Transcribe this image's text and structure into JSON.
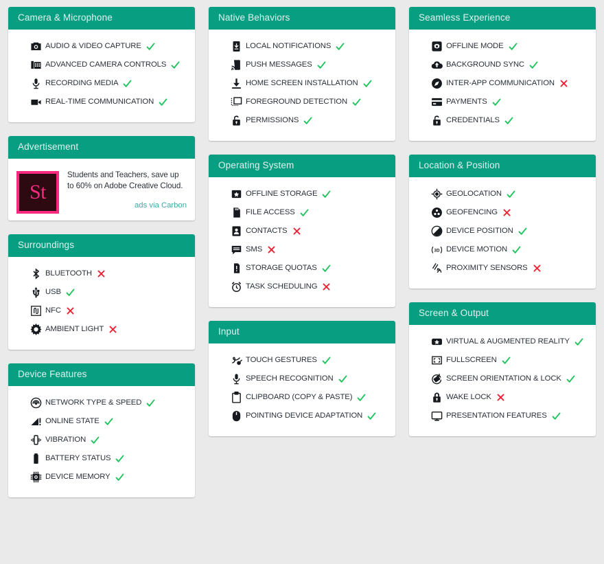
{
  "theme": {
    "header_bg": "#089e82",
    "page_bg": "#eaeaea",
    "card_bg": "#ffffff",
    "label_color": "#2a3039",
    "yes_color": "#1fc55c",
    "no_color": "#ee2233",
    "link_color": "#3fa9a2",
    "ad_accent": "#f72a7f",
    "ad_bg": "#2d0a12"
  },
  "columns": [
    {
      "cards": [
        {
          "title": "Camera & Microphone",
          "type": "features",
          "features": [
            {
              "icon": "camera-icon",
              "label": "AUDIO & VIDEO CAPTURE",
              "status": "yes"
            },
            {
              "icon": "advanced-camera-icon",
              "label": "ADVANCED CAMERA CONTROLS",
              "status": "yes"
            },
            {
              "icon": "microphone-icon",
              "label": "RECORDING MEDIA",
              "status": "yes"
            },
            {
              "icon": "video-camera-icon",
              "label": "REAL-TIME COMMUNICATION",
              "status": "yes"
            }
          ]
        },
        {
          "title": "Advertisement",
          "type": "ad",
          "ad": {
            "logo_text": "St",
            "body": "Students and Teachers, save up to 60% on Adobe Creative Cloud.",
            "link": "ads via Carbon"
          }
        },
        {
          "title": "Surroundings",
          "type": "features",
          "features": [
            {
              "icon": "bluetooth-icon",
              "label": "BLUETOOTH",
              "status": "no"
            },
            {
              "icon": "usb-icon",
              "label": "USB",
              "status": "yes"
            },
            {
              "icon": "nfc-icon",
              "label": "NFC",
              "status": "no"
            },
            {
              "icon": "ambient-light-icon",
              "label": "AMBIENT LIGHT",
              "status": "no"
            }
          ]
        },
        {
          "title": "Device Features",
          "type": "features",
          "features": [
            {
              "icon": "network-speed-icon",
              "label": "NETWORK TYPE & SPEED",
              "status": "yes"
            },
            {
              "icon": "online-state-icon",
              "label": "ONLINE STATE",
              "status": "yes"
            },
            {
              "icon": "vibration-icon",
              "label": "VIBRATION",
              "status": "yes"
            },
            {
              "icon": "battery-icon",
              "label": "BATTERY STATUS",
              "status": "yes"
            },
            {
              "icon": "memory-chip-icon",
              "label": "DEVICE MEMORY",
              "status": "yes"
            }
          ]
        }
      ]
    },
    {
      "cards": [
        {
          "title": "Native Behaviors",
          "type": "features",
          "features": [
            {
              "icon": "local-notification-icon",
              "label": "LOCAL NOTIFICATIONS",
              "status": "yes"
            },
            {
              "icon": "push-message-icon",
              "label": "PUSH MESSAGES",
              "status": "yes"
            },
            {
              "icon": "download-install-icon",
              "label": "HOME SCREEN INSTALLATION",
              "status": "yes"
            },
            {
              "icon": "foreground-detection-icon",
              "label": "FOREGROUND DETECTION",
              "status": "yes"
            },
            {
              "icon": "unlock-icon",
              "label": "PERMISSIONS",
              "status": "yes"
            }
          ]
        },
        {
          "title": "Operating System",
          "type": "features",
          "features": [
            {
              "icon": "offline-storage-icon",
              "label": "OFFLINE STORAGE",
              "status": "yes"
            },
            {
              "icon": "sd-card-icon",
              "label": "FILE ACCESS",
              "status": "yes"
            },
            {
              "icon": "contacts-icon",
              "label": "CONTACTS",
              "status": "no"
            },
            {
              "icon": "sms-icon",
              "label": "SMS",
              "status": "no"
            },
            {
              "icon": "storage-quota-icon",
              "label": "STORAGE QUOTAS",
              "status": "yes"
            },
            {
              "icon": "alarm-clock-icon",
              "label": "TASK SCHEDULING",
              "status": "no"
            }
          ]
        },
        {
          "title": "Input",
          "type": "features",
          "features": [
            {
              "icon": "touch-gesture-icon",
              "label": "TOUCH GESTURES",
              "status": "yes"
            },
            {
              "icon": "microphone-icon",
              "label": "SPEECH RECOGNITION",
              "status": "yes"
            },
            {
              "icon": "clipboard-icon",
              "label": "CLIPBOARD (COPY & PASTE)",
              "status": "yes"
            },
            {
              "icon": "mouse-icon",
              "label": "POINTING DEVICE ADAPTATION",
              "status": "yes"
            }
          ]
        }
      ]
    },
    {
      "cards": [
        {
          "title": "Seamless Experience",
          "type": "features",
          "features": [
            {
              "icon": "offline-mode-icon",
              "label": "OFFLINE MODE",
              "status": "yes"
            },
            {
              "icon": "cloud-upload-icon",
              "label": "BACKGROUND SYNC",
              "status": "yes"
            },
            {
              "icon": "compass-icon",
              "label": "INTER-APP COMMUNICATION",
              "status": "no"
            },
            {
              "icon": "credit-card-icon",
              "label": "PAYMENTS",
              "status": "yes"
            },
            {
              "icon": "unlock-icon",
              "label": "CREDENTIALS",
              "status": "yes"
            }
          ]
        },
        {
          "title": "Location & Position",
          "type": "features",
          "features": [
            {
              "icon": "geolocation-icon",
              "label": "GEOLOCATION",
              "status": "yes"
            },
            {
              "icon": "geofencing-icon",
              "label": "GEOFENCING",
              "status": "no"
            },
            {
              "icon": "device-position-icon",
              "label": "DEVICE POSITION",
              "status": "yes"
            },
            {
              "icon": "device-motion-icon",
              "label": "DEVICE MOTION",
              "status": "yes"
            },
            {
              "icon": "proximity-sensor-icon",
              "label": "PROXIMITY SENSORS",
              "status": "no"
            }
          ]
        },
        {
          "title": "Screen & Output",
          "type": "features",
          "features": [
            {
              "icon": "vr-ar-icon",
              "label": "VIRTUAL & AUGMENTED REALITY",
              "status": "yes"
            },
            {
              "icon": "fullscreen-icon",
              "label": "FULLSCREEN",
              "status": "yes"
            },
            {
              "icon": "screen-rotation-icon",
              "label": "SCREEN ORIENTATION & LOCK",
              "status": "yes"
            },
            {
              "icon": "lock-icon",
              "label": "WAKE LOCK",
              "status": "no"
            },
            {
              "icon": "presentation-screen-icon",
              "label": "PRESENTATION FEATURES",
              "status": "yes"
            }
          ]
        }
      ]
    }
  ]
}
